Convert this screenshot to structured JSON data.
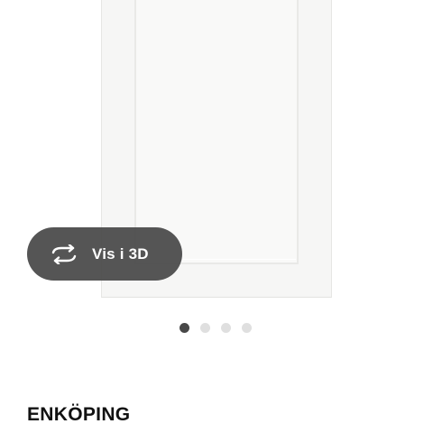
{
  "gallery": {
    "image_alt": "ENKÖPING door, white",
    "view3d_label": "Vis i 3D",
    "view3d_icon": "rotate-3d-icon",
    "dots": [
      {
        "active": true
      },
      {
        "active": false
      },
      {
        "active": false
      },
      {
        "active": false
      }
    ],
    "colors": {
      "button_bg": "#484848",
      "dot_active": "#484848",
      "dot_inactive": "#dfdfdf"
    }
  },
  "product": {
    "name": "ENKÖPING"
  }
}
